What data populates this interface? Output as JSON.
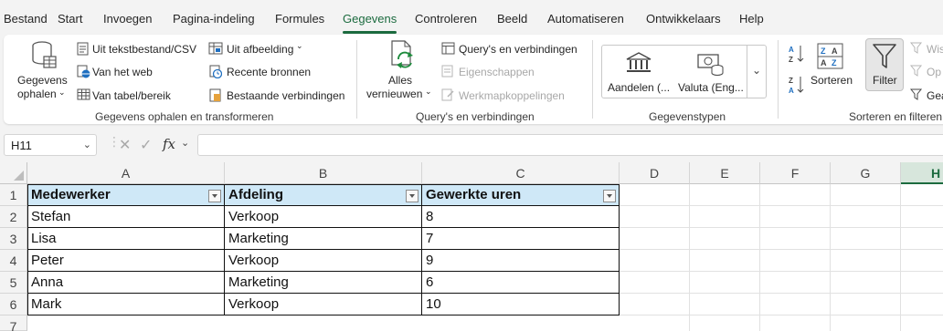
{
  "menu": {
    "tabs": [
      "Bestand",
      "Start",
      "Invoegen",
      "Pagina-indeling",
      "Formules",
      "Gegevens",
      "Controleren",
      "Beeld",
      "Automatiseren",
      "Ontwikkelaars",
      "Help"
    ],
    "active": "Gegevens"
  },
  "ribbon": {
    "get_data": {
      "big_label_1": "Gegevens",
      "big_label_2": "ophalen",
      "from_text": "Uit tekstbestand/CSV",
      "from_web": "Van het web",
      "from_table": "Van tabel/bereik",
      "from_picture": "Uit afbeelding",
      "recent_sources": "Recente bronnen",
      "existing_connections": "Bestaande verbindingen",
      "group_label": "Gegevens ophalen en transformeren"
    },
    "queries": {
      "refresh_1": "Alles",
      "refresh_2": "vernieuwen",
      "queries_connections": "Query's en verbindingen",
      "properties": "Eigenschappen",
      "workbook_links": "Werkmapkoppelingen",
      "group_label": "Query's en verbindingen"
    },
    "data_types": {
      "stocks": "Aandelen (...",
      "currencies": "Valuta (Eng...",
      "group_label": "Gegevenstypen"
    },
    "sort_filter": {
      "sort": "Sorteren",
      "filter": "Filter",
      "clear": "Wis",
      "reapply": "Op",
      "advanced": "Gea",
      "group_label": "Sorteren en filteren"
    }
  },
  "formula_bar": {
    "name_box": "H11",
    "fx": "fx",
    "value": ""
  },
  "sheet": {
    "columns": [
      "A",
      "B",
      "C",
      "D",
      "E",
      "F",
      "G",
      "H"
    ],
    "rows": [
      "1",
      "2",
      "3",
      "4",
      "5",
      "6",
      "7"
    ],
    "selected_column": "H",
    "table": {
      "headers": [
        "Medewerker",
        "Afdeling",
        "Gewerkte uren"
      ],
      "rows": [
        [
          "Stefan",
          "Verkoop",
          "8"
        ],
        [
          "Lisa",
          "Marketing",
          "7"
        ],
        [
          "Peter",
          "Verkoop",
          "9"
        ],
        [
          "Anna",
          "Marketing",
          "6"
        ],
        [
          "Mark",
          "Verkoop",
          "10"
        ]
      ]
    }
  },
  "colors": {
    "accent": "#1c6b3f",
    "table_header": "#cfe8f7",
    "selected_header": "#d7e6dc"
  }
}
